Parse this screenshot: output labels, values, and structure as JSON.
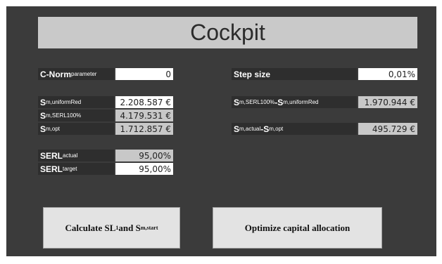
{
  "title": "Cockpit",
  "left": {
    "cnorm": {
      "label": "C-Norm",
      "label_sub": "parameter",
      "value": "0"
    },
    "s_uniform": {
      "label": "S",
      "label_sub": "m,uniformRed",
      "value": "2.208.587 €"
    },
    "s_serl100": {
      "label": "S",
      "label_sub": "m,SERL100%",
      "value": "4.179.531 €"
    },
    "s_opt": {
      "label": "S",
      "label_sub": "m,opt",
      "value": "1.712.857 €"
    },
    "serl_actual": {
      "label": "SERL",
      "label_sub": "actual",
      "value": "95,00%"
    },
    "serl_target": {
      "label": "SERL",
      "label_sub": "target",
      "value": "95,00%"
    }
  },
  "right": {
    "step": {
      "label": "Step size",
      "value": "0,01%"
    },
    "diff1": {
      "label_a": "S",
      "sub_a": "m,SERL100%",
      "label_b": "-S",
      "sub_b": "m,uniformRed",
      "value": "1.970.944 €"
    },
    "diff2": {
      "label_a": "S",
      "sub_a": "m,actual",
      "label_b": " -S",
      "sub_b": "m,opt",
      "value": "495.729 €"
    }
  },
  "buttons": {
    "calc_a": "Calculate SL",
    "calc_sub1": "1",
    "calc_b": " and S",
    "calc_sub2": "m,start",
    "optimize": "Optimize capital allocation"
  }
}
